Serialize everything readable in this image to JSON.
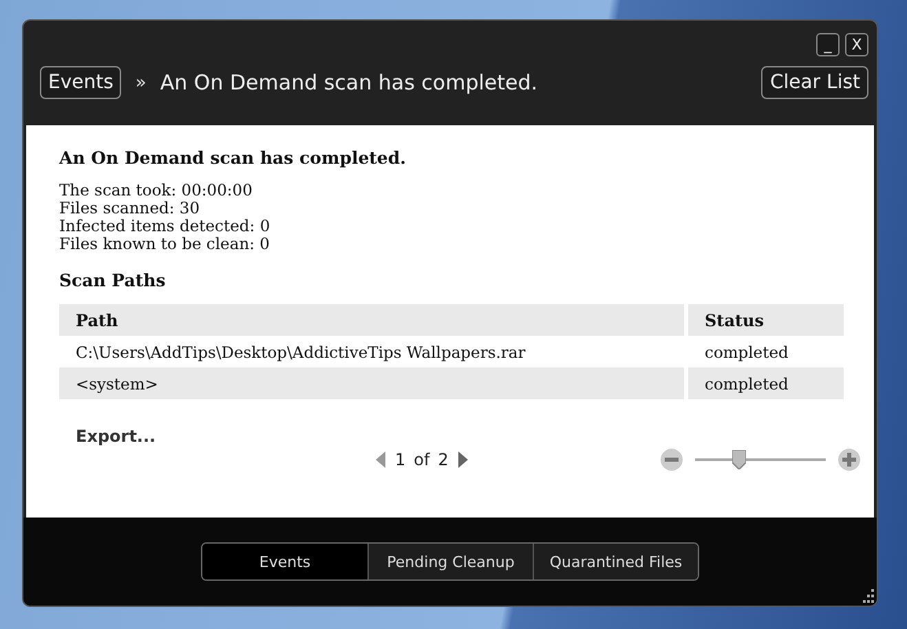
{
  "window": {
    "controls": [
      "_",
      "X"
    ]
  },
  "header": {
    "breadcrumb_root": "Events",
    "separator": "»",
    "title": "An On Demand scan has completed.",
    "clear_button": "Clear List"
  },
  "detail": {
    "heading": "An On Demand scan has completed.",
    "stats": [
      "The scan took: 00:00:00",
      "Files scanned: 30",
      "Infected items detected: 0",
      "Files known to be clean: 0"
    ],
    "section_heading": "Scan Paths"
  },
  "table": {
    "columns": [
      "Path",
      "Status"
    ],
    "rows": [
      {
        "path": "C:\\Users\\AddTips\\Desktop\\AddictiveTips Wallpapers.rar",
        "status": "completed"
      },
      {
        "path": "<system>",
        "status": "completed"
      }
    ]
  },
  "export_link": "Export...",
  "pager": {
    "current": "1",
    "of": "of",
    "total": "2"
  },
  "zoom": {
    "level": 0.3
  },
  "tabs": [
    {
      "label": "Events",
      "selected": true
    },
    {
      "label": "Pending Cleanup",
      "selected": false
    },
    {
      "label": "Quarantined Files",
      "selected": false
    }
  ]
}
